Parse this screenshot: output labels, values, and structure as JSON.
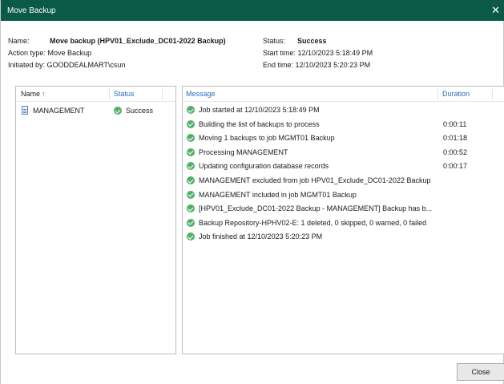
{
  "window": {
    "title": "Move Backup",
    "close_glyph": "✕"
  },
  "info": {
    "name_label": "Name:",
    "name_value": "Move backup (HPV01_Exclude_DC01-2022 Backup)",
    "action_label": "Action type:",
    "action_value": "Move Backup",
    "initiated_label": "Initiated by:",
    "initiated_value": "GOODDEALMART\\csun",
    "status_label": "Status:",
    "status_value": "Success",
    "start_label": "Start time:",
    "start_value": "12/10/2023 5:18:49 PM",
    "end_label": "End time:",
    "end_value": "12/10/2023 5:20:23 PM"
  },
  "objects": {
    "col_name": "Name",
    "sort_arrow": "↑",
    "col_status": "Status",
    "rows": [
      {
        "name": "MANAGEMENT",
        "status": "Success"
      }
    ]
  },
  "log": {
    "col_message": "Message",
    "col_duration": "Duration",
    "rows": [
      {
        "message": "Job started at 12/10/2023 5:18:49 PM",
        "duration": ""
      },
      {
        "message": "Building the list of backups to process",
        "duration": "0:00:11"
      },
      {
        "message": "Moving 1 backups to job MGMT01 Backup",
        "duration": "0:01:18"
      },
      {
        "message": "Processing MANAGEMENT",
        "duration": "0:00:52"
      },
      {
        "message": "Updating configuration database records",
        "duration": "0:00:17"
      },
      {
        "message": "MANAGEMENT excluded from job HPV01_Exclude_DC01-2022 Backup",
        "duration": ""
      },
      {
        "message": "MANAGEMENT included in job MGMT01 Backup",
        "duration": ""
      },
      {
        "message": "[HPV01_Exclude_DC01-2022 Backup - MANAGEMENT] Backup has b...",
        "duration": ""
      },
      {
        "message": "Backup Repository-HPHV02-E: 1 deleted, 0 skipped, 0 warned, 0 failed",
        "duration": ""
      },
      {
        "message": "Job finished at 12/10/2023 5:20:23 PM",
        "duration": ""
      }
    ]
  },
  "footer": {
    "close_label": "Close"
  },
  "colors": {
    "titlebar": "#0b5a46",
    "success": "#53b06b",
    "header_link": "#2a6ebb"
  }
}
